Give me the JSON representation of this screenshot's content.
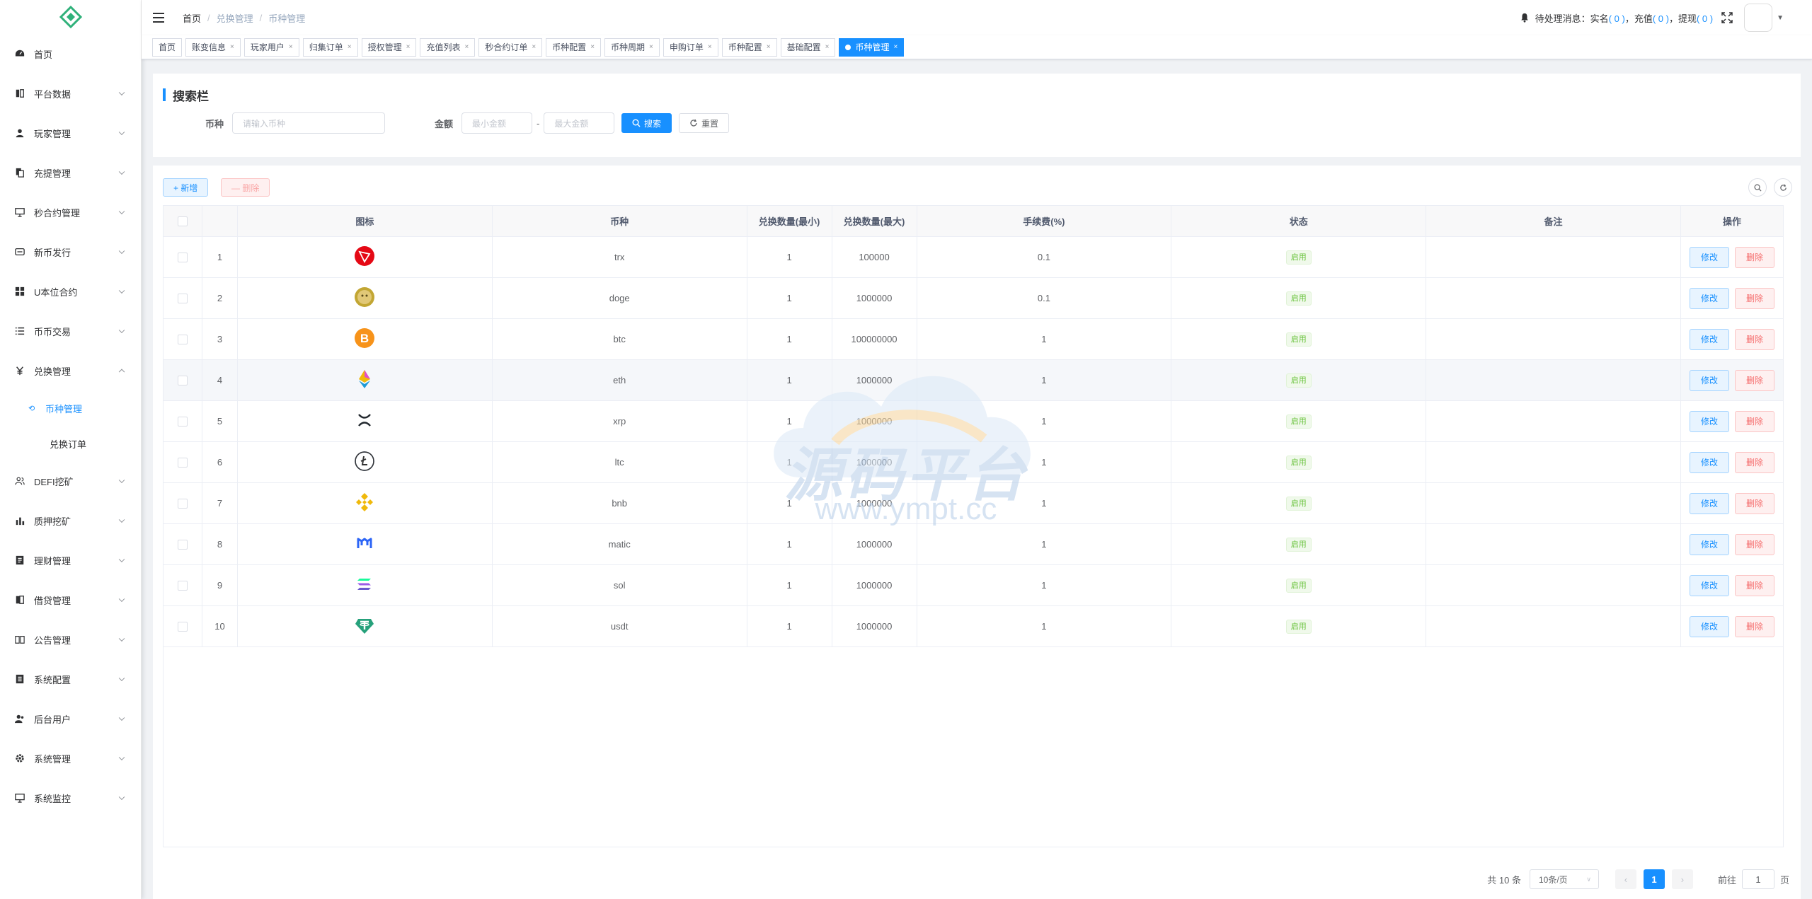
{
  "sidebar": {
    "items": [
      {
        "label": "首页",
        "icon": "dashboard-icon"
      },
      {
        "label": "平台数据",
        "icon": "chart-book-icon"
      },
      {
        "label": "玩家管理",
        "icon": "user-icon"
      },
      {
        "label": "充提管理",
        "icon": "copy-icon"
      },
      {
        "label": "秒合约管理",
        "icon": "monitor-icon"
      },
      {
        "label": "新币发行",
        "icon": "coin-icon"
      },
      {
        "label": "U本位合约",
        "icon": "grid-icon"
      },
      {
        "label": "币币交易",
        "icon": "list-icon"
      },
      {
        "label": "兑换管理",
        "icon": "yen-icon"
      },
      {
        "label": "DEFI挖矿",
        "icon": "people-icon"
      },
      {
        "label": "质押挖矿",
        "icon": "bar-chart-icon"
      },
      {
        "label": "理财管理",
        "icon": "doc-icon"
      },
      {
        "label": "借贷管理",
        "icon": "book-icon"
      },
      {
        "label": "公告管理",
        "icon": "open-book-icon"
      },
      {
        "label": "系统配置",
        "icon": "form-icon"
      },
      {
        "label": "后台用户",
        "icon": "peoples-icon"
      },
      {
        "label": "系统管理",
        "icon": "gear-icon"
      },
      {
        "label": "系统监控",
        "icon": "monitor-icon"
      }
    ],
    "submenu": [
      {
        "label": "币种管理"
      },
      {
        "label": "兑换订单"
      }
    ]
  },
  "header": {
    "breadcrumb": [
      "首页",
      "兑换管理",
      "币种管理"
    ],
    "pending_label": "待处理消息：实名",
    "pending_real": "( 0 )",
    "pending_recharge_label": "，充值",
    "pending_recharge": "( 0 )",
    "pending_withdraw_label": "，提现",
    "pending_withdraw": "( 0 )"
  },
  "tags": [
    {
      "label": "首页",
      "closable": false
    },
    {
      "label": "账变信息",
      "closable": true
    },
    {
      "label": "玩家用户",
      "closable": true
    },
    {
      "label": "归集订单",
      "closable": true
    },
    {
      "label": "授权管理",
      "closable": true
    },
    {
      "label": "充值列表",
      "closable": true
    },
    {
      "label": "秒合约订单",
      "closable": true
    },
    {
      "label": "币种配置",
      "closable": true
    },
    {
      "label": "币种周期",
      "closable": true
    },
    {
      "label": "申购订单",
      "closable": true
    },
    {
      "label": "币种配置",
      "closable": true
    },
    {
      "label": "基础配置",
      "closable": true
    },
    {
      "label": "币种管理",
      "closable": true,
      "active": true
    }
  ],
  "search": {
    "title": "搜索栏",
    "coin_label": "币种",
    "coin_placeholder": "请输入币种",
    "amount_label": "金额",
    "min_placeholder": "最小金额",
    "dash": "-",
    "max_placeholder": "最大金额",
    "search_btn": "搜索",
    "reset_btn": "重置"
  },
  "toolbar": {
    "add": "+ 新增",
    "del": "— 删除"
  },
  "table": {
    "headers": [
      "图标",
      "币种",
      "兑换数量(最小)",
      "兑换数量(最大)",
      "手续费(%)",
      "状态",
      "备注",
      "操作"
    ],
    "edit_label": "修改",
    "delete_label": "删除",
    "rows": [
      {
        "idx": "1",
        "coin": "trx",
        "icon": "trx-icon",
        "min": "1",
        "max": "100000",
        "fee": "0.1",
        "status": "启用",
        "remark": ""
      },
      {
        "idx": "2",
        "coin": "doge",
        "icon": "doge-icon",
        "min": "1",
        "max": "1000000",
        "fee": "0.1",
        "status": "启用",
        "remark": ""
      },
      {
        "idx": "3",
        "coin": "btc",
        "icon": "btc-icon",
        "min": "1",
        "max": "100000000",
        "fee": "1",
        "status": "启用",
        "remark": ""
      },
      {
        "idx": "4",
        "coin": "eth",
        "icon": "eth-icon",
        "min": "1",
        "max": "1000000",
        "fee": "1",
        "status": "启用",
        "remark": ""
      },
      {
        "idx": "5",
        "coin": "xrp",
        "icon": "xrp-icon",
        "min": "1",
        "max": "1000000",
        "fee": "1",
        "status": "启用",
        "remark": ""
      },
      {
        "idx": "6",
        "coin": "ltc",
        "icon": "ltc-icon",
        "min": "1",
        "max": "1000000",
        "fee": "1",
        "status": "启用",
        "remark": ""
      },
      {
        "idx": "7",
        "coin": "bnb",
        "icon": "bnb-icon",
        "min": "1",
        "max": "1000000",
        "fee": "1",
        "status": "启用",
        "remark": ""
      },
      {
        "idx": "8",
        "coin": "matic",
        "icon": "matic-icon",
        "min": "1",
        "max": "1000000",
        "fee": "1",
        "status": "启用",
        "remark": ""
      },
      {
        "idx": "9",
        "coin": "sol",
        "icon": "sol-icon",
        "min": "1",
        "max": "1000000",
        "fee": "1",
        "status": "启用",
        "remark": ""
      },
      {
        "idx": "10",
        "coin": "usdt",
        "icon": "usdt-icon",
        "min": "1",
        "max": "1000000",
        "fee": "1",
        "status": "启用",
        "remark": ""
      }
    ]
  },
  "pagination": {
    "total": "共 10 条",
    "page_size": "10条/页",
    "current": "1",
    "goto_label": "前往",
    "goto_value": "1",
    "page_suffix": "页"
  },
  "watermark": {
    "title": "源码平台",
    "url": "www.ympt.cc"
  },
  "colors": {
    "accent": "#1890ff",
    "success": "#67c23a",
    "danger": "#f56c6c"
  }
}
